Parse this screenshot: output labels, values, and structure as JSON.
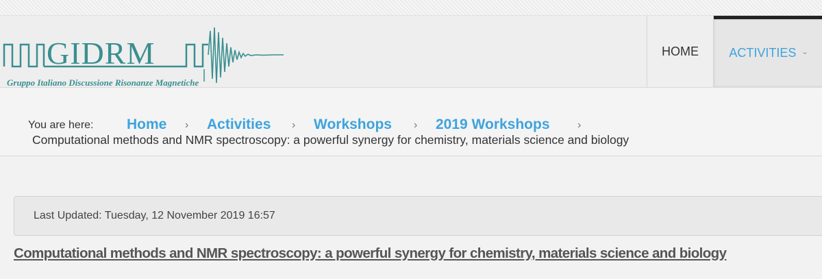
{
  "logo": {
    "word": "GIDRM",
    "subtitle": "Gruppo Italiano Discussione Risonanze Magnetiche",
    "color": "#3a8f8f"
  },
  "nav": {
    "items": [
      {
        "label": "HOME"
      },
      {
        "label": "ACTIVITIES",
        "active": true,
        "icon": "chevron-down-icon"
      }
    ],
    "accent": "#3ea3dc"
  },
  "breadcrumb": {
    "label": "You are here:",
    "links": [
      "Home",
      "Activities",
      "Workshops",
      "2019 Workshops"
    ],
    "separator": "›",
    "current": "Computational methods and NMR spectroscopy: a powerful synergy for chemistry, materials science and biology"
  },
  "article": {
    "last_updated": "Last Updated: Tuesday, 12 November 2019 16:57",
    "title": "Computational methods and NMR spectroscopy: a powerful synergy for chemistry, materials science and biology"
  }
}
